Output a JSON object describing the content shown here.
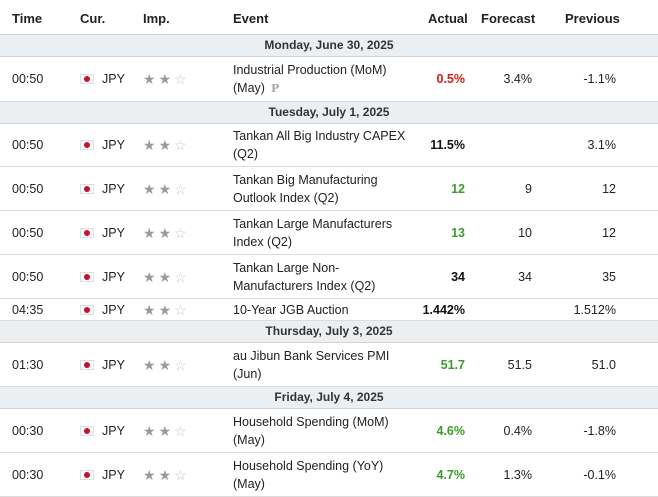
{
  "columns": {
    "time": "Time",
    "currency": "Cur.",
    "importance": "Imp.",
    "event": "Event",
    "actual": "Actual",
    "forecast": "Forecast",
    "previous": "Previous"
  },
  "colors": {
    "positive": "#3b9c2a",
    "negative": "#d0211c",
    "neutral": "#111111",
    "day_header_bg": "#eceff2"
  },
  "icons": {
    "flag": "japan-flag-icon",
    "star_filled": "star-filled-icon",
    "star_empty": "star-empty-icon",
    "preliminary": "preliminary-p-icon"
  },
  "groups": [
    {
      "date": "Monday, June 30, 2025",
      "events": [
        {
          "time": "00:50",
          "currency": "JPY",
          "importance": 2,
          "event_line1": "Industrial Production (MoM)",
          "event_line2": "(May)",
          "preliminary": "P",
          "actual": "0.5%",
          "actual_color": "red",
          "forecast": "3.4%",
          "previous": "-1.1%"
        }
      ]
    },
    {
      "date": "Tuesday, July 1, 2025",
      "events": [
        {
          "time": "00:50",
          "currency": "JPY",
          "importance": 2,
          "event_line1": "Tankan All Big Industry CAPEX",
          "event_line2": "(Q2)",
          "actual": "11.5%",
          "actual_color": "black",
          "forecast": "",
          "previous": "3.1%"
        },
        {
          "time": "00:50",
          "currency": "JPY",
          "importance": 2,
          "event_line1": "Tankan Big Manufacturing",
          "event_line2": "Outlook Index (Q2)",
          "actual": "12",
          "actual_color": "green",
          "forecast": "9",
          "previous": "12"
        },
        {
          "time": "00:50",
          "currency": "JPY",
          "importance": 2,
          "event_line1": "Tankan Large Manufacturers",
          "event_line2": "Index (Q2)",
          "actual": "13",
          "actual_color": "green",
          "forecast": "10",
          "previous": "12"
        },
        {
          "time": "00:50",
          "currency": "JPY",
          "importance": 2,
          "event_line1": "Tankan Large Non-",
          "event_line2": "Manufacturers Index (Q2)",
          "actual": "34",
          "actual_color": "black",
          "forecast": "34",
          "previous": "35"
        },
        {
          "time": "04:35",
          "currency": "JPY",
          "importance": 2,
          "event_line1": "10-Year JGB Auction",
          "event_line2": "",
          "actual": "1.442%",
          "actual_color": "black",
          "forecast": "",
          "previous": "1.512%"
        }
      ]
    },
    {
      "date": "Thursday, July 3, 2025",
      "events": [
        {
          "time": "01:30",
          "currency": "JPY",
          "importance": 2,
          "event_line1": "au Jibun Bank Services PMI",
          "event_line2": "(Jun)",
          "actual": "51.7",
          "actual_color": "green",
          "forecast": "51.5",
          "previous": "51.0"
        }
      ]
    },
    {
      "date": "Friday, July 4, 2025",
      "events": [
        {
          "time": "00:30",
          "currency": "JPY",
          "importance": 2,
          "event_line1": "Household Spending (MoM)",
          "event_line2": "(May)",
          "actual": "4.6%",
          "actual_color": "green",
          "forecast": "0.4%",
          "previous": "-1.8%"
        },
        {
          "time": "00:30",
          "currency": "JPY",
          "importance": 2,
          "event_line1": "Household Spending (YoY)",
          "event_line2": "(May)",
          "actual": "4.7%",
          "actual_color": "green",
          "forecast": "1.3%",
          "previous": "-0.1%"
        }
      ]
    }
  ]
}
